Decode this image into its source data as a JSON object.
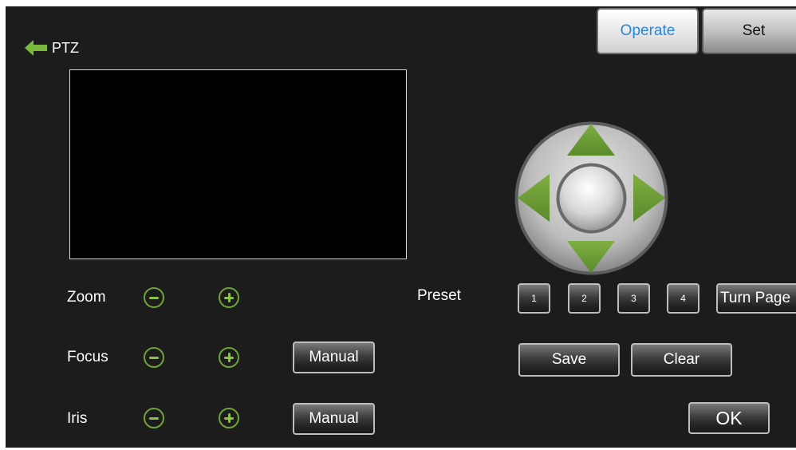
{
  "header": {
    "back_icon": "left-arrow-icon",
    "title": "PTZ"
  },
  "tabs": [
    {
      "label": "Operate",
      "active": true
    },
    {
      "label": "Set",
      "active": false
    }
  ],
  "controls": {
    "zoom_label": "Zoom",
    "focus_label": "Focus",
    "iris_label": "Iris",
    "focus_mode": "Manual",
    "iris_mode": "Manual"
  },
  "preset": {
    "label": "Preset",
    "buttons": [
      "1",
      "2",
      "3",
      "4"
    ],
    "turn_page": "Turn Page",
    "save": "Save",
    "clear": "Clear"
  },
  "ok_label": "OK",
  "colors": {
    "background": "#1c1c1c",
    "accent_green": "#6fa33a",
    "active_tab_text": "#2a86d8"
  }
}
